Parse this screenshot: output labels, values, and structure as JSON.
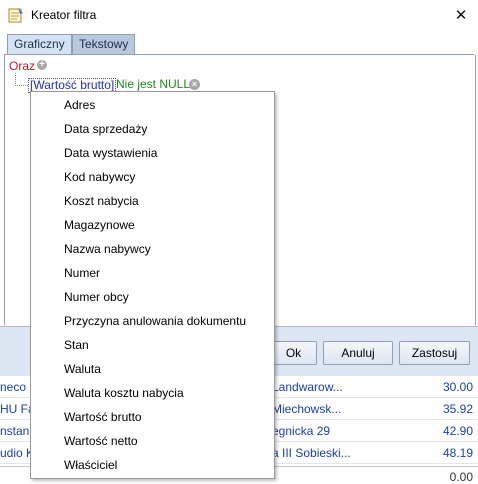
{
  "window": {
    "title": "Kreator filtra"
  },
  "icons": {
    "app": "filter-builder-icon",
    "close": "close-icon",
    "add": "plus-circle-icon",
    "remove": "x-circle-icon"
  },
  "tabs": [
    {
      "label": "Graficzny",
      "active": true
    },
    {
      "label": "Tekstowy",
      "active": false
    }
  ],
  "editor": {
    "group_operator": "Oraz",
    "condition_field": "[Wartość brutto]",
    "condition_operator": "Nie jest NULL"
  },
  "buttons": {
    "ok": "Ok",
    "cancel": "Anuluj",
    "apply": "Zastosuj"
  },
  "dropdown": {
    "items": [
      "Adres",
      "Data sprzedaży",
      "Data wystawienia",
      "Kod nabywcy",
      "Koszt nabycia",
      "Magazynowe",
      "Nazwa nabywcy",
      "Numer",
      "Numer obcy",
      "Przyczyna anulowania dokumentu",
      "Stan",
      "Waluta",
      "Waluta kosztu nabycia",
      "Wartość brutto",
      "Wartość netto",
      "Właściciel"
    ]
  },
  "background_rows": [
    {
      "c1": "neco",
      "c2": "Landwarow...",
      "c3": "30.00"
    },
    {
      "c1": "HU Fa",
      "c2": "Miechowsk...",
      "c3": "35.92"
    },
    {
      "c1": "nstan",
      "c2": "egnicka 29",
      "c3": "42.90"
    },
    {
      "c1": "udio K",
      "c2": "a III Sobieski...",
      "c3": "48.19"
    }
  ],
  "footer_total": "0.00"
}
